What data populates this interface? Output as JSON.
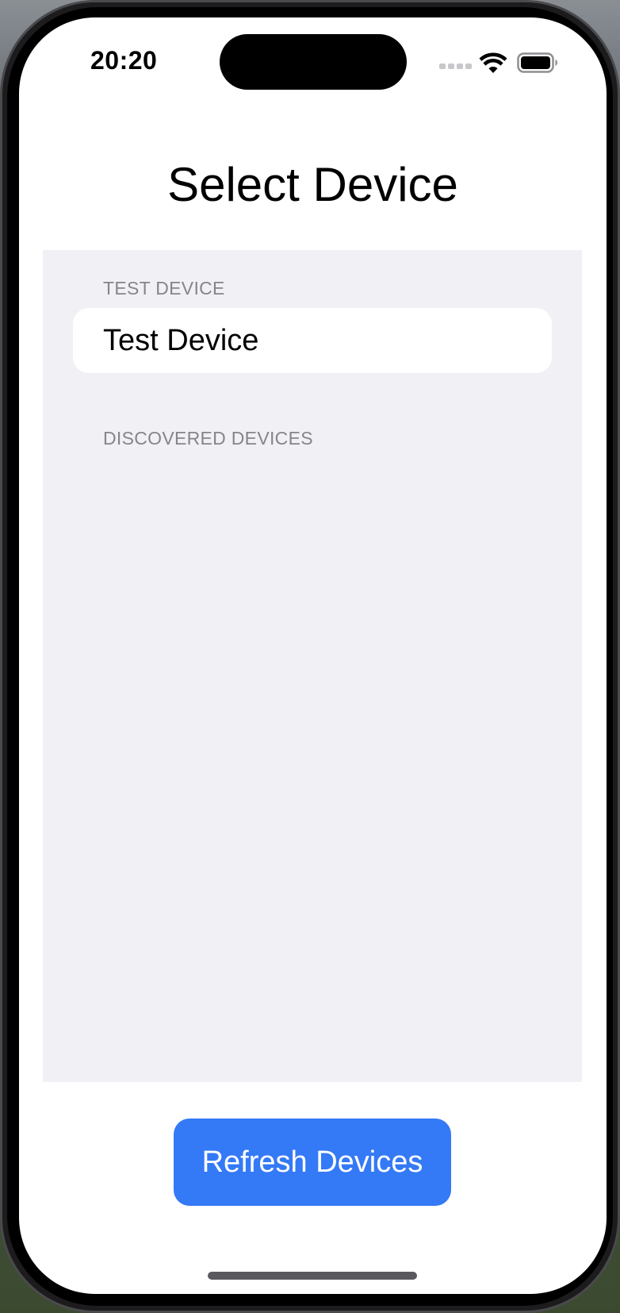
{
  "status_bar": {
    "time": "20:20"
  },
  "page": {
    "title": "Select Device"
  },
  "sections": {
    "test_device": {
      "header": "TEST DEVICE",
      "items": [
        {
          "label": "Test Device"
        }
      ]
    },
    "discovered_devices": {
      "header": "DISCOVERED DEVICES",
      "items": []
    }
  },
  "actions": {
    "refresh_label": "Refresh Devices"
  },
  "colors": {
    "accent": "#3479f6",
    "list_background": "#f1f0f5",
    "section_header": "#85858a"
  },
  "icons": {
    "cell": "cell-signal-icon",
    "wifi": "wifi-icon",
    "battery": "battery-icon"
  }
}
